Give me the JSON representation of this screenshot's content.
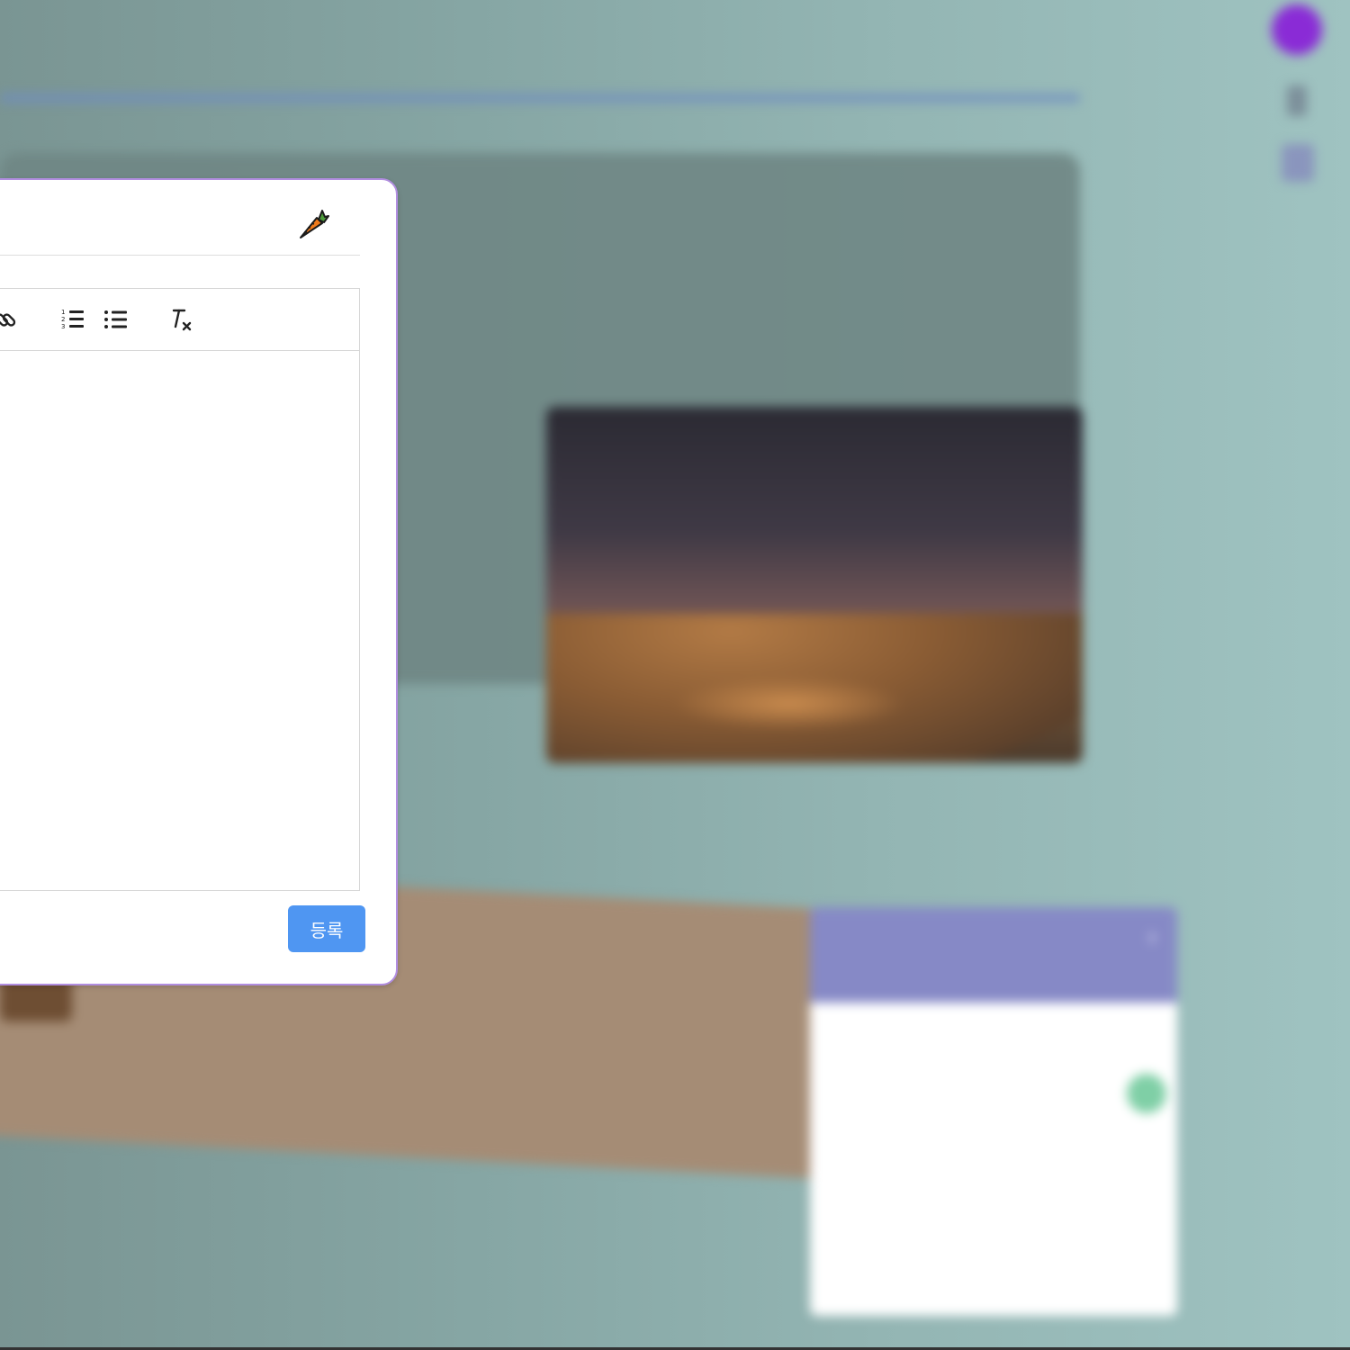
{
  "background": {
    "banner_text": "",
    "calendar": {
      "title": "",
      "next_symbol": "›",
      "weekdays": [
        "",
        "",
        "",
        "",
        "",
        "",
        ""
      ],
      "days": [
        {
          "d": "",
          "dim": true
        },
        {
          "d": "",
          "dim": true
        },
        {
          "d": "",
          "dim": true
        },
        {
          "d": "",
          "dim": true
        },
        {
          "d": "",
          "dim": true
        },
        {
          "d": "",
          "dim": true
        },
        {
          "d": "",
          "dim": true
        },
        {
          "d": "",
          "dim": true
        },
        {
          "d": "",
          "dim": true
        },
        {
          "d": "",
          "dim": true
        },
        {
          "d": "",
          "dim": true
        },
        {
          "d": "",
          "dim": true
        },
        {
          "d": "",
          "dim": false
        },
        {
          "d": "",
          "dim": false,
          "selected": true
        },
        {
          "d": ""
        },
        {
          "d": ""
        },
        {
          "d": ""
        },
        {
          "d": ""
        },
        {
          "d": ""
        },
        {
          "d": ""
        },
        {
          "d": ""
        },
        {
          "d": ""
        },
        {
          "d": ""
        },
        {
          "d": ""
        },
        {
          "d": ""
        },
        {
          "d": ""
        },
        {
          "d": ""
        },
        {
          "d": ""
        },
        {
          "d": ""
        },
        {
          "d": ""
        },
        {
          "d": ""
        },
        {
          "d": ""
        },
        {
          "d": ""
        },
        {
          "d": ""
        },
        {
          "d": ""
        },
        {
          "d": ""
        },
        {
          "d": ""
        },
        {
          "d": ""
        },
        {
          "d": ""
        },
        {
          "d": ""
        },
        {
          "d": ""
        },
        {
          "d": ""
        }
      ]
    }
  },
  "dialog": {
    "header_icon": "carrot-icon",
    "toolbar": [
      {
        "name": "link-icon"
      },
      {
        "name": "ordered-list-icon"
      },
      {
        "name": "bullet-list-icon"
      },
      {
        "name": "clear-format-icon"
      }
    ],
    "editor_text": "",
    "submit_label": "등록"
  },
  "colors": {
    "accent": "#4f96f2",
    "dialog_border": "#b18de0",
    "calendar_header": "#8689c6",
    "calendar_selected": "#7fcfa6"
  }
}
